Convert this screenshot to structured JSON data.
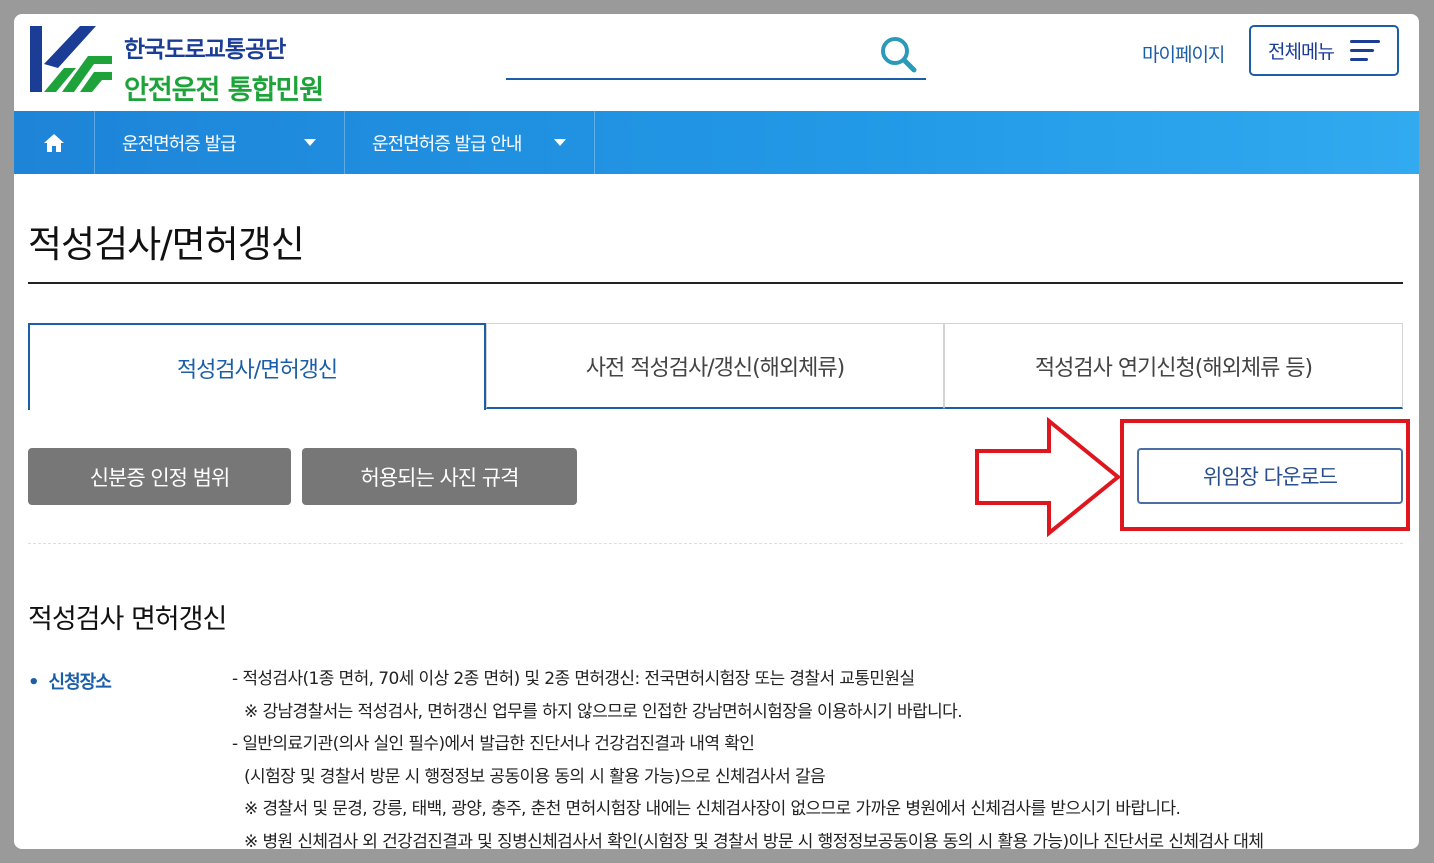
{
  "header": {
    "org_name": "한국도로교통공단",
    "site_name": "안전운전 통합민원",
    "search_placeholder": "",
    "mypage_label": "마이페이지",
    "allmenu_label": "전체메뉴"
  },
  "nav": {
    "items": [
      {
        "label": "운전면허증 발급"
      },
      {
        "label": "운전면허증 발급 안내"
      }
    ]
  },
  "page": {
    "title": "적성검사/면허갱신"
  },
  "tabs": [
    {
      "label": "적성검사/면허갱신",
      "active": true
    },
    {
      "label": "사전 적성검사/갱신(해외체류)",
      "active": false
    },
    {
      "label": "적성검사 연기신청(해외체류 등)",
      "active": false
    }
  ],
  "buttons": {
    "id_range": "신분증 인정 범위",
    "photo_spec": "허용되는 사진 규격",
    "proxy_download": "위임장 다운로드"
  },
  "section": {
    "title": "적성검사 면허갱신",
    "bullet_label": "신청장소",
    "lines": [
      "- 적성검사(1종 면허, 70세 이상 2종 면허) 및 2종 면허갱신: 전국면허시험장 또는 경찰서 교통민원실",
      "  ※ 강남경찰서는 적성검사, 면허갱신 업무를 하지 않으므로 인접한 강남면허시험장을 이용하시기 바랍니다.",
      "- 일반의료기관(의사 실인 필수)에서 발급한 진단서나 건강검진결과 내역 확인",
      "  (시험장 및 경찰서 방문 시 행정정보 공동이용 동의 시 활용 가능)으로 신체검사서 갈음",
      "  ※ 경찰서 및 문경, 강릉, 태백, 광양, 충주, 춘천 면허시험장 내에는 신체검사장이 없으므로 가까운 병원에서 신체검사를 받으시기 바랍니다.",
      "  ※ 병원 신체검사 외 건강검진결과 및 징병신체검사서 확인(시험장 및 경찰서 방문 시 행정정보공동이용 동의 시 활용 가능)이나 진단서로 신체검사 대체"
    ]
  },
  "colors": {
    "brand_blue": "#1b5ea8",
    "brand_green": "#1ea33a",
    "nav_blue": "#2299e6",
    "highlight_red": "#e0161e",
    "gray_button": "#777777"
  }
}
